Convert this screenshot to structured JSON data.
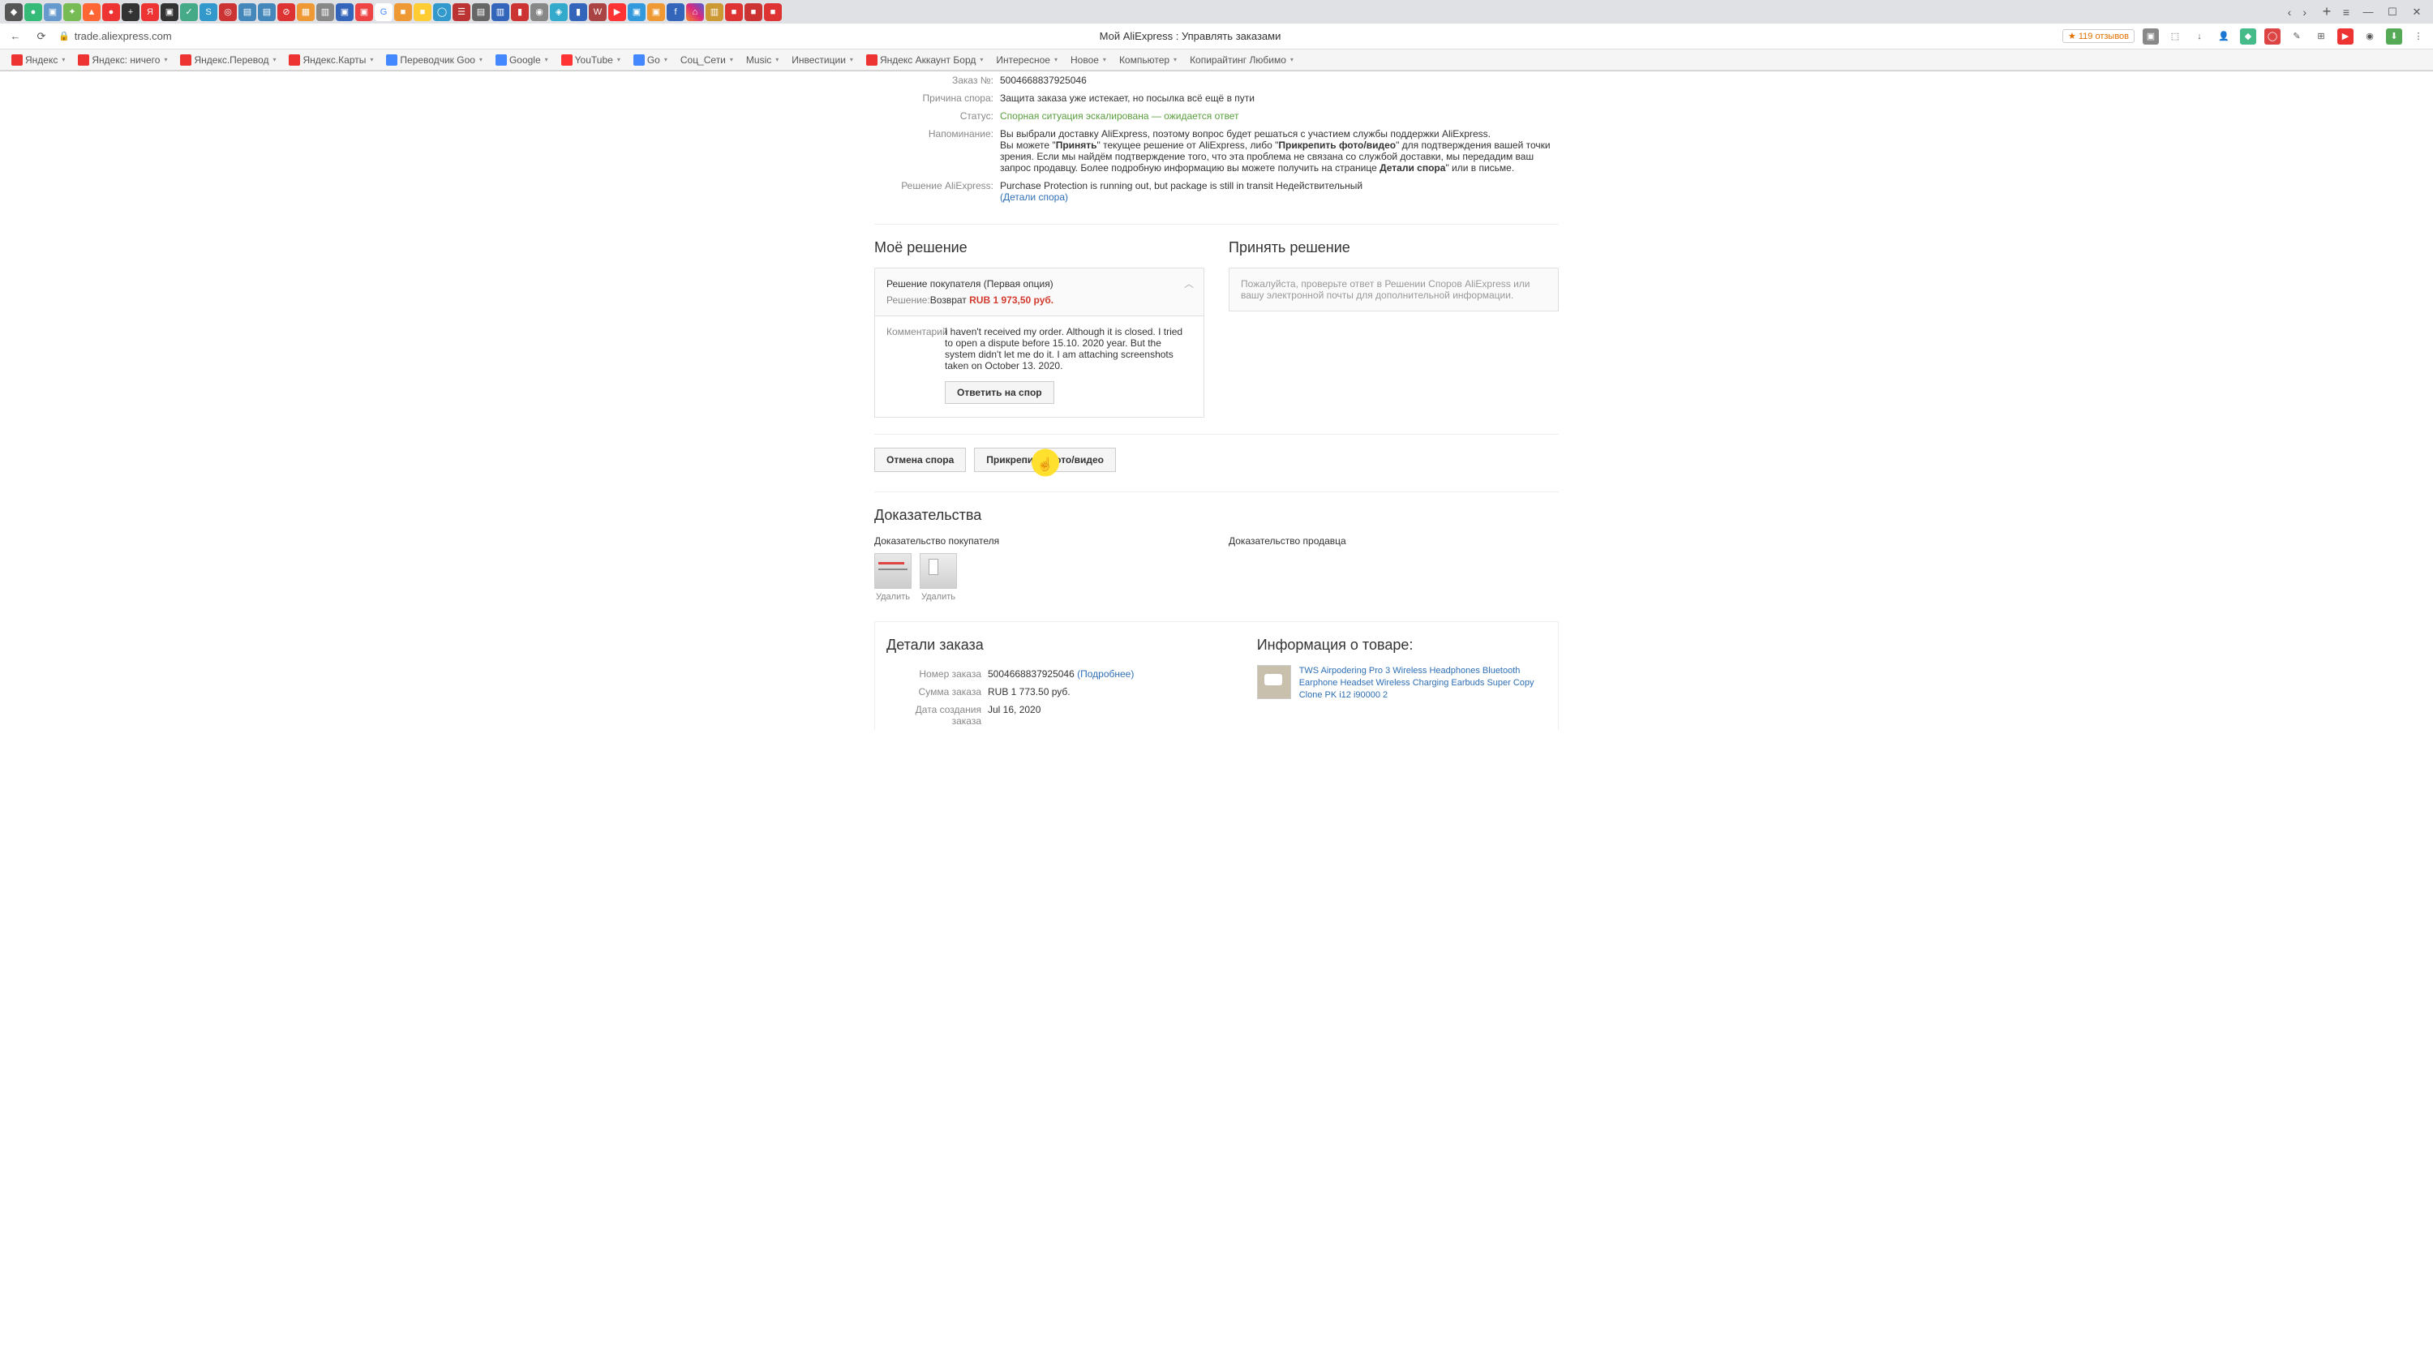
{
  "browser": {
    "url": "trade.aliexpress.com",
    "page_title": "Мой AliExpress : Управлять заказами",
    "reviews_badge": "119 отзывов",
    "tabs_nav": {
      "back": "‹",
      "forward": "›"
    },
    "window": {
      "min": "—",
      "max": "☐",
      "close": "✕"
    }
  },
  "bookmarks": [
    "Яндекс",
    "Яндекс: ничего",
    "Яндекс.Перевод",
    "Яндекс.Карты",
    "Переводчик Goo",
    "Google",
    "YouTube",
    "Go",
    "Соц_Сети",
    "Music",
    "Инвестиции",
    "Яндекс Аккаунт Борд",
    "Интересное",
    "Новое",
    "Компьютер",
    "Копирайтинг Любимо"
  ],
  "dispute": {
    "order_no_label": "Заказ №:",
    "order_no": "5004668837925046",
    "reason_label": "Причина спора:",
    "reason": "Защита заказа уже истекает, но посылка всё ещё в пути",
    "status_label": "Статус:",
    "status": "Спорная ситуация эскалирована — ожидается ответ",
    "reminder_label": "Напоминание:",
    "reminder_pre": "Вы выбрали доставку AliExpress, поэтому вопрос будет решаться с участием службы поддержки AliExpress.\nВы можете \"",
    "reminder_accept": "Принять",
    "reminder_mid1": "\" текущее решение от AliExpress, либо \"",
    "reminder_attach": "Прикрепить фото/видео",
    "reminder_mid2": "\" для подтверждения вашей точки зрения. Если мы найдём подтверждение того, что эта проблема не связана со службой доставки, мы передадим ваш запрос продавцу. Более подробную информацию вы можете получить на странице ",
    "reminder_details": "Детали спора",
    "reminder_tail": "\" или в письме.",
    "ali_decision_label": "Решение AliExpress:",
    "ali_decision": "Purchase Protection is running out, but package is still in transit  Недействительный",
    "ali_details_link": "(Детали спора)"
  },
  "my_decision": {
    "heading": "Моё решение",
    "option_title": "Решение покупателя (Первая опция)",
    "solution_label": "Решение:",
    "solution_text": "Возврат ",
    "solution_price": "RUB 1 973,50 руб.",
    "comment_label": "Комментарий",
    "comment_text": "I haven't received my order. Although it is closed. I tried to open a dispute before 15.10. 2020 year. But the system didn't let me do it. I am attaching screenshots taken on October 13. 2020.",
    "reply_btn": "Ответить на спор"
  },
  "accept": {
    "heading": "Принять решение",
    "text": "Пожалуйста, проверьте ответ в Решении Споров AliExpress или вашу электронной почты для дополнительной информации."
  },
  "actions": {
    "cancel": "Отмена спора",
    "attach": "Прикрепить фото/видео"
  },
  "evidence": {
    "heading": "Доказательства",
    "buyer_title": "Доказательство покупателя",
    "seller_title": "Доказательство продавца",
    "delete": "Удалить"
  },
  "order_details": {
    "heading": "Детали заказа",
    "num_label": "Номер заказа",
    "num": "5004668837925046",
    "num_more": "(Подробнее)",
    "sum_label": "Сумма заказа",
    "sum": "RUB 1 773.50 руб.",
    "date_label": "Дата создания заказа",
    "date": "Jul 16, 2020"
  },
  "product": {
    "heading": "Информация о товаре:",
    "name": "TWS Airpodering Pro 3 Wireless Headphones Bluetooth Earphone Headset Wireless Charging Earbuds Super Copy Clone PK i12 i90000 2"
  }
}
